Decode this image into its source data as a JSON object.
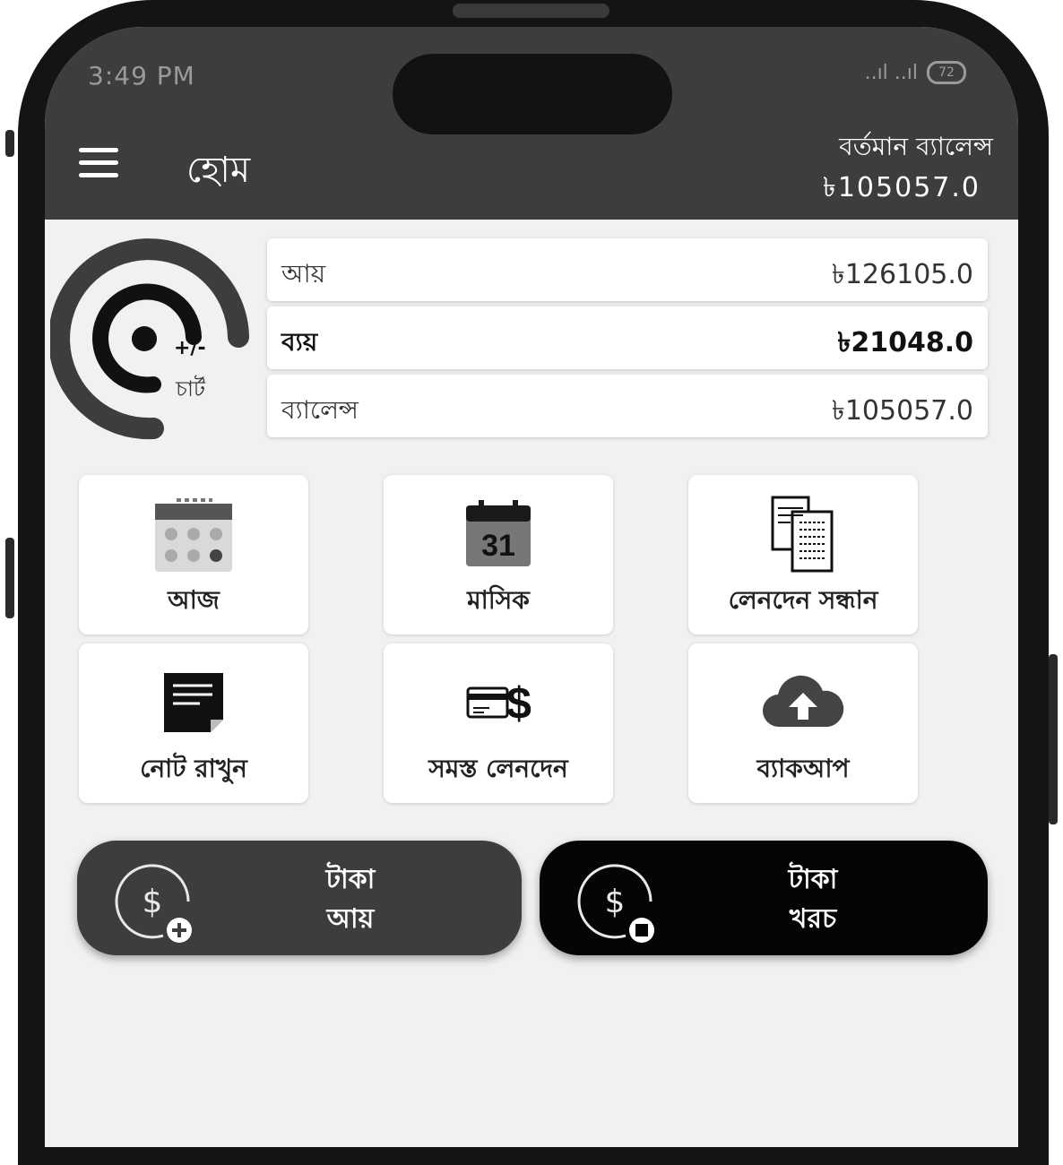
{
  "status_bar": {
    "time": "3:49 PM",
    "signal": "..ıl ..ıl",
    "battery": "72"
  },
  "app_bar": {
    "title": "হোম",
    "balance_label": "বর্তমান ব্যালেন্স",
    "balance_value": "৳105057.0"
  },
  "chart_button": {
    "sign": "+/-",
    "label": "চার্ট"
  },
  "summary": [
    {
      "label": "আয়",
      "value": "৳126105.0"
    },
    {
      "label": "ব্যয়",
      "value": "৳21048.0"
    },
    {
      "label": "ব্যালেন্স",
      "value": "৳105057.0"
    }
  ],
  "tiles": [
    {
      "label": "আজ",
      "icon": "calendar-today-icon"
    },
    {
      "label": "মাসিক",
      "icon": "calendar-monthly-icon",
      "day": "31"
    },
    {
      "label": "লেনদেন সন্ধান",
      "icon": "search-transactions-icon"
    },
    {
      "label": "নোট রাখুন",
      "icon": "note-icon"
    },
    {
      "label": "সমস্ত লেনদেন",
      "icon": "all-transactions-icon"
    },
    {
      "label": "ব্যাকআপ",
      "icon": "cloud-upload-icon"
    }
  ],
  "actions": {
    "income": {
      "line1": "টাকা",
      "line2": "আয়",
      "icon": "dollar-plus-icon",
      "color": "#3d3d3d"
    },
    "expense": {
      "line1": "টাকা",
      "line2": "খরচ",
      "icon": "dollar-minus-icon",
      "color": "#050505"
    }
  }
}
